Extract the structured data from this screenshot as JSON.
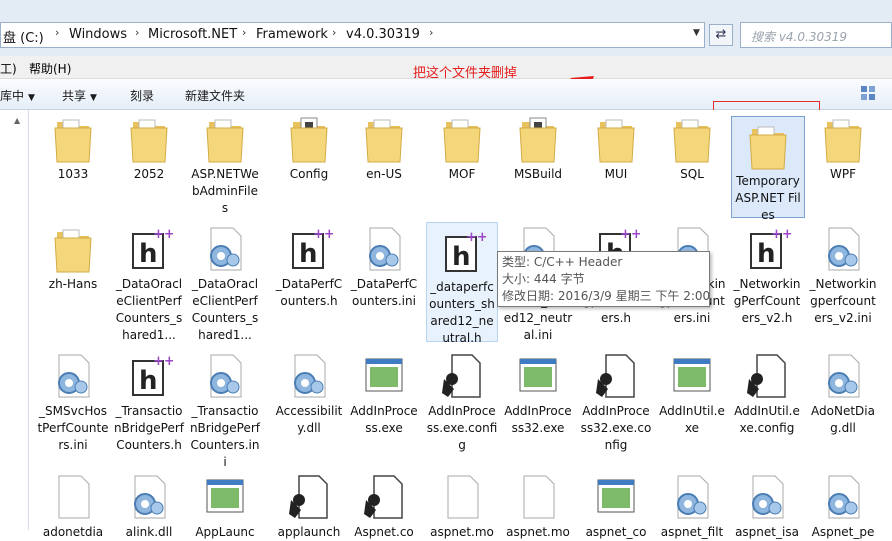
{
  "address": {
    "crumbs": [
      "盘 (C:)",
      "Windows",
      "Microsoft.NET",
      "Framework",
      "v4.0.30319"
    ],
    "search_placeholder": "搜索 v4.0.30319"
  },
  "menu": {
    "left_fragment": "工)",
    "help": "帮助(H)"
  },
  "annotation": "把这个文件夹删掉",
  "toolbar": {
    "library_fragment": "库中",
    "share": "共享",
    "burn": "刻录",
    "new_folder": "新建文件夹"
  },
  "tooltip": {
    "type": "类型: C/C++ Header",
    "size": "大小: 444 字节",
    "modified": "修改日期: 2016/3/9 星期三 下午 2:00"
  },
  "files": [
    {
      "name": "1033",
      "icon": "folder"
    },
    {
      "name": "2052",
      "icon": "folder"
    },
    {
      "name": "ASP.NETWebAdminFiles",
      "icon": "folder"
    },
    {
      "name": "Config",
      "icon": "folder-docs"
    },
    {
      "name": "en-US",
      "icon": "folder"
    },
    {
      "name": "MOF",
      "icon": "folder"
    },
    {
      "name": "MSBuild",
      "icon": "folder-docs"
    },
    {
      "name": "MUI",
      "icon": "folder"
    },
    {
      "name": "SQL",
      "icon": "folder"
    },
    {
      "name": "Temporary ASP.NET Files",
      "icon": "folder",
      "selected": true
    },
    {
      "name": "WPF",
      "icon": "folder"
    },
    {
      "name": "zh-Hans",
      "icon": "folder"
    },
    {
      "name": "_DataOracleClientPerfCounters_shared1...",
      "icon": "header-file"
    },
    {
      "name": "_DataOracleClientPerfCounters_shared1...",
      "icon": "settings-file"
    },
    {
      "name": "_DataPerfCounters.h",
      "icon": "header-file"
    },
    {
      "name": "_DataPerfCounters.ini",
      "icon": "settings-file"
    },
    {
      "name": "_dataperfcounters_shared12_neutral.h",
      "icon": "header-file",
      "hover": true
    },
    {
      "name": "_dataperfcounters_shared12_neutral.ini",
      "icon": "settings-file"
    },
    {
      "name": "_Networkingperfcounters.h",
      "icon": "header-file"
    },
    {
      "name": "_Networkingperfcounters.ini",
      "icon": "settings-file"
    },
    {
      "name": "_NetworkingPerfCounters_v2.h",
      "icon": "header-file"
    },
    {
      "name": "_Networkingperfcounters_v2.ini",
      "icon": "settings-file"
    },
    {
      "name": "_SMSvcHostPerfCounters.ini",
      "icon": "settings-file"
    },
    {
      "name": "_TransactionBridgePerfCounters.h",
      "icon": "header-file"
    },
    {
      "name": "_TransactionBridgePerfCounters.ini",
      "icon": "settings-file"
    },
    {
      "name": "Accessibility.dll",
      "icon": "settings-file"
    },
    {
      "name": "AddInProcess.exe",
      "icon": "exe"
    },
    {
      "name": "AddInProcess.exe.config",
      "icon": "config-file"
    },
    {
      "name": "AddInProcess32.exe",
      "icon": "exe"
    },
    {
      "name": "AddInProcess32.exe.config",
      "icon": "config-file"
    },
    {
      "name": "AddInUtil.exe",
      "icon": "exe"
    },
    {
      "name": "AddInUtil.exe.config",
      "icon": "config-file"
    },
    {
      "name": "AdoNetDiag.dll",
      "icon": "settings-file"
    },
    {
      "name": "adonetdia",
      "icon": "blank-file"
    },
    {
      "name": "alink.dll",
      "icon": "settings-file"
    },
    {
      "name": "AppLaunc",
      "icon": "exe"
    },
    {
      "name": "applaunch",
      "icon": "config-file"
    },
    {
      "name": "Aspnet.co",
      "icon": "config-file"
    },
    {
      "name": "aspnet.mo",
      "icon": "blank-file"
    },
    {
      "name": "aspnet.mo",
      "icon": "blank-file"
    },
    {
      "name": "aspnet_co",
      "icon": "exe"
    },
    {
      "name": "aspnet_filt",
      "icon": "settings-file"
    },
    {
      "name": "aspnet_isa",
      "icon": "settings-file"
    },
    {
      "name": "Aspnet_pe",
      "icon": "settings-file"
    }
  ]
}
